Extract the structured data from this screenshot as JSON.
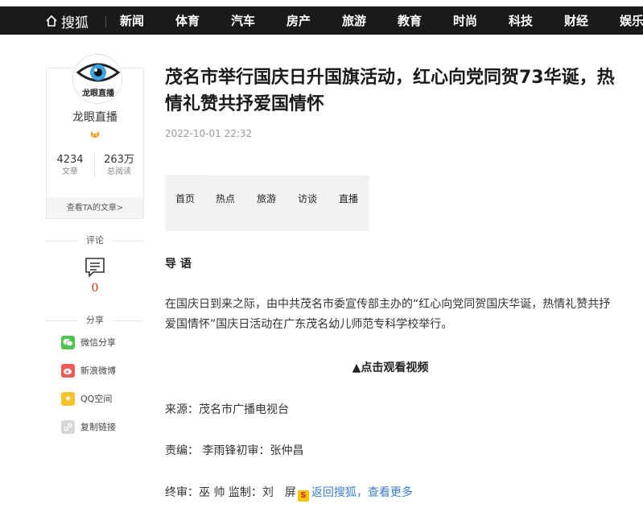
{
  "nav": {
    "logo": "搜狐",
    "items": [
      "新闻",
      "体育",
      "汽车",
      "房产",
      "旅游",
      "教育",
      "时尚",
      "科技",
      "财经",
      "娱乐"
    ]
  },
  "author": {
    "avatar_text": "龙眼直播",
    "name": "龙眼直播",
    "articles_count": "4234",
    "articles_label": "文章",
    "reads_count": "263万",
    "reads_label": "总阅读",
    "view_articles": "查看TA的文章>"
  },
  "side": {
    "comment_title": "评论",
    "comment_count": "0",
    "share_title": "分享",
    "share_items": [
      "微信分享",
      "新浪微博",
      "QQ空间",
      "复制链接"
    ]
  },
  "article": {
    "title": "茂名市举行国庆日升国旗活动，红心向党同贺73华诞，热情礼赞共抒爱国情怀",
    "date": "2022-10-01 22:32",
    "tabs": [
      "首页",
      "热点",
      "旅游",
      "访谈",
      "直播"
    ],
    "lead_title": "导 语",
    "paragraph": "在国庆日到来之际，由中共茂名市委宣传部主办的“红心向党同贺国庆华诞，热情礼赞共抒爱国情怀”国庆日活动在广东茂名幼儿师范专科学校举行。",
    "video_link": "▲点击观看视频",
    "source": "来源：茂名市广播电视台",
    "editor": "责编： 李雨锋初审：张仲昌",
    "final_review": "终审：巫 帅 监制：刘　屏",
    "back_link": "返回搜狐，查看更多"
  }
}
